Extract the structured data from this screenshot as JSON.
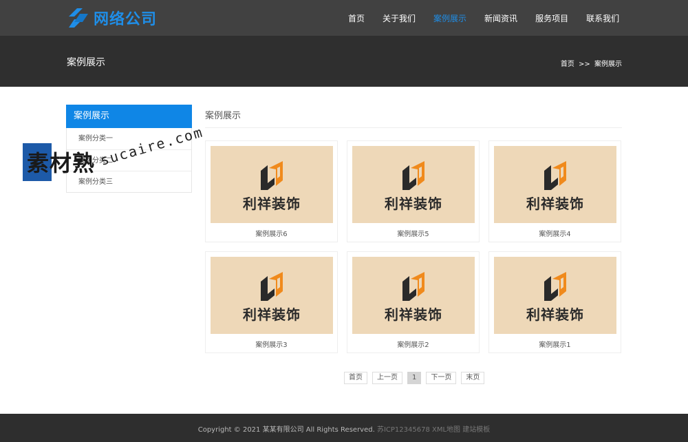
{
  "header": {
    "logo_text": "网络公司",
    "nav": [
      {
        "label": "首页"
      },
      {
        "label": "关于我们"
      },
      {
        "label": "案例展示"
      },
      {
        "label": "新闻资讯"
      },
      {
        "label": "服务项目"
      },
      {
        "label": "联系我们"
      }
    ],
    "active_index": 2,
    "accent_color": "#1f8ee8"
  },
  "banner": {
    "title": "案例展示",
    "breadcrumb_home": "首页",
    "breadcrumb_sep": ">>",
    "breadcrumb_current": "案例展示"
  },
  "sidebar": {
    "heading": "案例展示",
    "items": [
      {
        "label": "案例分类一"
      },
      {
        "label": "案例分类二"
      },
      {
        "label": "案例分类三"
      }
    ]
  },
  "watermark": {
    "cn": "素材熟",
    "en": "sucaire.com"
  },
  "content": {
    "title": "案例展示",
    "cases": [
      {
        "caption": "案例展示6",
        "brand": "利祥装饰"
      },
      {
        "caption": "案例展示5",
        "brand": "利祥装饰"
      },
      {
        "caption": "案例展示4",
        "brand": "利祥装饰"
      },
      {
        "caption": "案例展示3",
        "brand": "利祥装饰"
      },
      {
        "caption": "案例展示2",
        "brand": "利祥装饰"
      },
      {
        "caption": "案例展示1",
        "brand": "利祥装饰"
      }
    ]
  },
  "pagination": {
    "first": "首页",
    "prev": "上一页",
    "current": "1",
    "next": "下一页",
    "last": "末页"
  },
  "footer": {
    "copyright": "Copyright © 2021 某某有限公司 All Rights Reserved.",
    "links": "苏ICP12345678 XML地图 建站模板"
  }
}
